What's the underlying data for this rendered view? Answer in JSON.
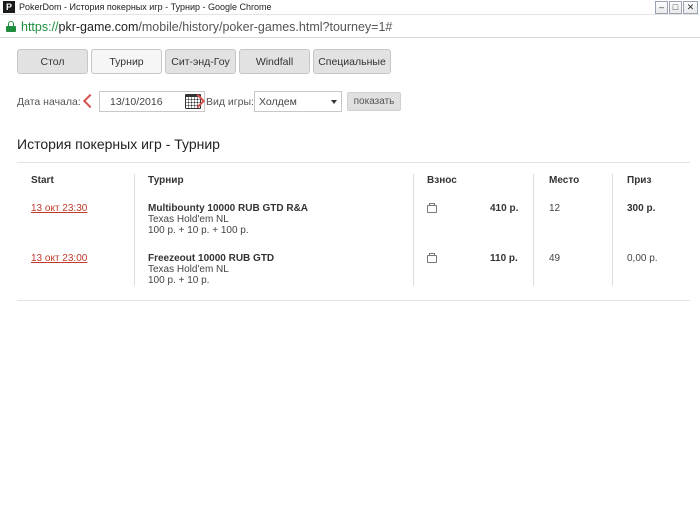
{
  "window": {
    "title": "PokerDom - История покерных игр - Турнир - Google Chrome",
    "logo_text": "P",
    "controls": [
      "–",
      "□",
      "✕"
    ]
  },
  "address": {
    "scheme": "https://",
    "host": "pkr-game.com",
    "path": "/mobile/history/poker-games.html?tourney=1#"
  },
  "tabs": [
    "Стол",
    "Турнир",
    "Сит-энд-Гоу",
    "Windfall",
    "Специальные"
  ],
  "filter": {
    "date_label": "Дата начала:",
    "date_value": "13/10/2016",
    "game_label": "Вид игры:",
    "game_value": "Холдем",
    "show_label": "показать"
  },
  "page_title": "История покерных игр - Турнир",
  "table": {
    "headers": [
      "Start",
      "Турнир",
      "Взнос",
      "Место",
      "Приз"
    ],
    "rows": [
      {
        "start": "13 окт 23:30",
        "name": "Multibounty 10000 RUB GTD R&A",
        "game": "Texas Hold'em NL",
        "buyin_detail": "100 р. + 10 р. + 100 р.",
        "fee": "410 р.",
        "place": "12",
        "prize": "300 р."
      },
      {
        "start": "13 окт 23:00",
        "name": "Freezeout 10000 RUB GTD",
        "game": "Texas Hold'em NL",
        "buyin_detail": "100 р. + 10 р.",
        "fee": "110 р.",
        "place": "49",
        "prize": "0,00 р."
      }
    ]
  },
  "colors": {
    "accent_red": "#c0392b",
    "secure_green": "#1e8e3e"
  },
  "icons": {
    "calendar": "calendar-icon",
    "ticket": "ticket-icon",
    "lock": "lock-icon"
  }
}
